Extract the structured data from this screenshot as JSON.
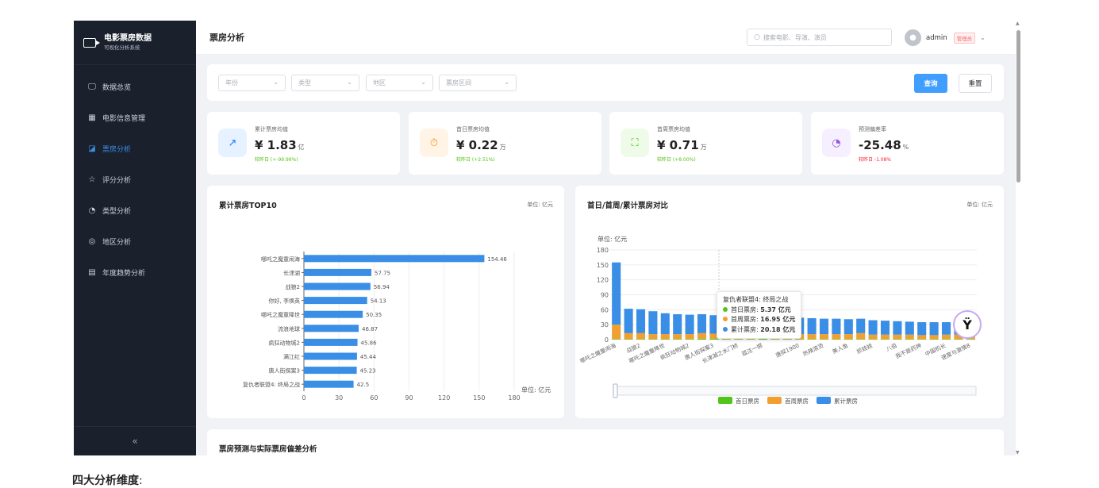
{
  "sidebar": {
    "app_title": "电影票房数据",
    "app_subtitle": "可视化分析系统",
    "items": [
      {
        "label": "数据总览",
        "icon": "monitor-icon",
        "glyph": "🖵"
      },
      {
        "label": "电影信息管理",
        "icon": "film-icon",
        "glyph": "▦"
      },
      {
        "label": "票房分析",
        "icon": "chart-icon",
        "glyph": "◪",
        "active": true
      },
      {
        "label": "评分分析",
        "icon": "star-icon",
        "glyph": "☆"
      },
      {
        "label": "类型分析",
        "icon": "pie-icon",
        "glyph": "◔"
      },
      {
        "label": "地区分析",
        "icon": "location-icon",
        "glyph": "◎"
      },
      {
        "label": "年度趋势分析",
        "icon": "calendar-icon",
        "glyph": "▤"
      }
    ],
    "collapse_glyph": "«"
  },
  "header": {
    "title": "票房分析",
    "search_placeholder": "搜索电影、导演、演员",
    "username": "admin",
    "role": "管理员"
  },
  "filters": {
    "year": "年份",
    "genre": "类型",
    "region": "地区",
    "range": "票房区间",
    "query_label": "查询",
    "reset_label": "重置"
  },
  "cards": [
    {
      "label": "累计票房均值",
      "value": "¥ 1.83",
      "unit": "亿",
      "change": "较昨日 (+-99.99%)",
      "change_color": "#52c41a",
      "icon": "trend-icon",
      "glyph": "↗",
      "icon_bg": "#e6f2ff",
      "icon_color": "#1677ff"
    },
    {
      "label": "首日票房均值",
      "value": "¥ 0.22",
      "unit": "万",
      "change": "较昨日 (+2.51%)",
      "change_color": "#52c41a",
      "icon": "timer-icon",
      "glyph": "⏱",
      "icon_bg": "#fff4e5",
      "icon_color": "#fa8c16"
    },
    {
      "label": "首周票房均值",
      "value": "¥ 0.71",
      "unit": "万",
      "change": "较昨日 (+8.00%)",
      "change_color": "#52c41a",
      "icon": "presentation-icon",
      "glyph": "⛶",
      "icon_bg": "#effbe9",
      "icon_color": "#52c41a"
    },
    {
      "label": "预测偏差率",
      "value": "-25.48",
      "unit": "%",
      "change": "较昨日 -1.08%",
      "change_color": "#f5222d",
      "icon": "pie-chart-icon",
      "glyph": "◔",
      "icon_bg": "#f6efff",
      "icon_color": "#9254de"
    }
  ],
  "panels": {
    "top10_title": "累计票房TOP10",
    "top10_unit": "单位: 亿元",
    "compare_title": "首日/首周/累计票房对比",
    "compare_unit": "单位: 亿元",
    "bottom_title": "票房预测与实际票房偏差分析"
  },
  "tooltip": {
    "title": "复仇者联盟4: 终局之战",
    "rows": [
      {
        "label": "首日票房: ",
        "value": "5.37 亿元",
        "color": "#52c41a"
      },
      {
        "label": "首周票房: ",
        "value": "16.95 亿元",
        "color": "#f0a030"
      },
      {
        "label": "累计票房: ",
        "value": "20.18 亿元",
        "color": "#3a8ee6"
      }
    ]
  },
  "chart_data": [
    {
      "type": "bar",
      "orientation": "horizontal",
      "categories": [
        "哪吒之魔童闹海",
        "长津湖",
        "战狼2",
        "你好, 李焕英",
        "哪吒之魔童降世",
        "流浪地球",
        "疯狂动物城2",
        "满江红",
        "唐人街探案3",
        "复仇者联盟4: 终局之战"
      ],
      "values": [
        154.46,
        57.75,
        56.94,
        54.13,
        50.35,
        46.87,
        45.86,
        45.44,
        45.23,
        42.5
      ],
      "value_labels": [
        "154.46",
        "57.75",
        "56.94",
        "54.13",
        "50.35",
        "46.87",
        "45.86",
        "45.44",
        "45.23",
        "42.5"
      ],
      "xticks": [
        "0",
        "30",
        "60",
        "90",
        "120",
        "150",
        "180"
      ],
      "xlim": [
        0,
        180
      ],
      "xlabel": "单位: 亿元",
      "color": "#3a8ee6"
    },
    {
      "type": "bar",
      "stacked": true,
      "ylabel": "单位: 亿元",
      "yticks": [
        "0",
        "30",
        "60",
        "90",
        "120",
        "150",
        "180"
      ],
      "ylim": [
        0,
        180
      ],
      "categories_visible": [
        "哪吒之魔童闹海",
        "战狼2",
        "哪吒之魔童降世",
        "疯狂动物城2",
        "唐人街探案3",
        "长津湖之水门桥",
        "孤注一掷",
        "唐探1900",
        "热辣滚烫",
        "美人鱼",
        "抓娃娃",
        "八佰",
        "我不是药神",
        "中国机长",
        "速度与激情8"
      ],
      "series": [
        {
          "name": "首日票房",
          "color": "#52c41a",
          "values": [
            1,
            1,
            1,
            1,
            1,
            1,
            1,
            2,
            2,
            1,
            1,
            1,
            2,
            1,
            1,
            1,
            1,
            1,
            1,
            1,
            1,
            1,
            1,
            1,
            1,
            1,
            1,
            1,
            1,
            1
          ]
        },
        {
          "name": "首周票房",
          "color": "#f0a030",
          "values": [
            29,
            12,
            12,
            10,
            10,
            10,
            10,
            11,
            10,
            16,
            14,
            12,
            12,
            12,
            11,
            10,
            10,
            10,
            10,
            10,
            12,
            9,
            9,
            9,
            9,
            8,
            8,
            9,
            9,
            8
          ]
        },
        {
          "name": "累计票房",
          "color": "#3a8ee6",
          "values": [
            125,
            49,
            48,
            46,
            42,
            40,
            39,
            38,
            37,
            20,
            39,
            36,
            35,
            34,
            33,
            33,
            32,
            31,
            31,
            30,
            29,
            29,
            28,
            27,
            26,
            26,
            26,
            25,
            25,
            26
          ]
        }
      ]
    }
  ],
  "footer": {
    "heading": "四大分析维度",
    "colon": ":"
  },
  "fab_glyph": "Ÿ"
}
